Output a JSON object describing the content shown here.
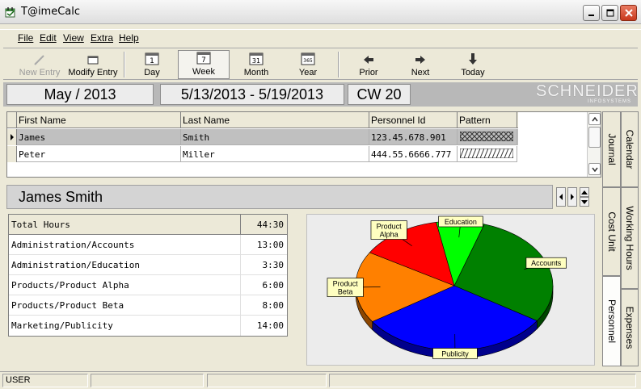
{
  "window": {
    "title": "T@imeCalc"
  },
  "menu": {
    "file": "File",
    "edit": "Edit",
    "view": "View",
    "extra": "Extra",
    "help": "Help"
  },
  "toolbar": {
    "new_entry": "New Entry",
    "modify_entry": "Modify Entry",
    "day": "Day",
    "week": "Week",
    "month": "Month",
    "year": "Year",
    "prior": "Prior",
    "next": "Next",
    "today": "Today",
    "day_icon_text": "1",
    "week_icon_text": "7",
    "month_icon_text": "31",
    "year_icon_text": "365"
  },
  "datebar": {
    "month": "May / 2013",
    "range": "5/13/2013 - 5/19/2013",
    "week": "CW 20"
  },
  "logo": {
    "name": "SCHNEIDER",
    "sub": "INFOSYSTEMS"
  },
  "grid": {
    "columns": [
      "First Name",
      "Last Name",
      "Personnel Id",
      "Pattern"
    ],
    "rows": [
      {
        "first": "James",
        "last": "Smith",
        "id": "123.45.678.901"
      },
      {
        "first": "Peter",
        "last": "Miller",
        "id": "444.55.6666.777"
      }
    ]
  },
  "selected_person": {
    "name": "James Smith"
  },
  "hours": {
    "total_label": "Total Hours",
    "total_value": "44:30",
    "rows": [
      {
        "name": "Administration/Accounts",
        "value": "13:00"
      },
      {
        "name": "Administration/Education",
        "value": "3:30"
      },
      {
        "name": "Products/Product Alpha",
        "value": "6:00"
      },
      {
        "name": "Products/Product Beta",
        "value": "8:00"
      },
      {
        "name": "Marketing/Publicity",
        "value": "14:00"
      }
    ]
  },
  "chart_data": {
    "type": "pie",
    "slices": [
      {
        "label": "Accounts",
        "value": 13,
        "color": "#008000"
      },
      {
        "label": "Publicity",
        "value": 14,
        "color": "#0000ff"
      },
      {
        "label": "Product Beta",
        "value": 8,
        "color": "#ff8000"
      },
      {
        "label": "Product Alpha",
        "value": 6,
        "color": "#ff0000"
      },
      {
        "label": "Education",
        "value": 3.5,
        "color": "#00ff00"
      }
    ]
  },
  "tabs": {
    "calendar": "Calendar",
    "journal": "Journal",
    "working_hours": "Working Hours",
    "cost_unit": "Cost Unit",
    "expenses": "Expenses",
    "personnel": "Personnel"
  },
  "status": {
    "user": "USER"
  }
}
